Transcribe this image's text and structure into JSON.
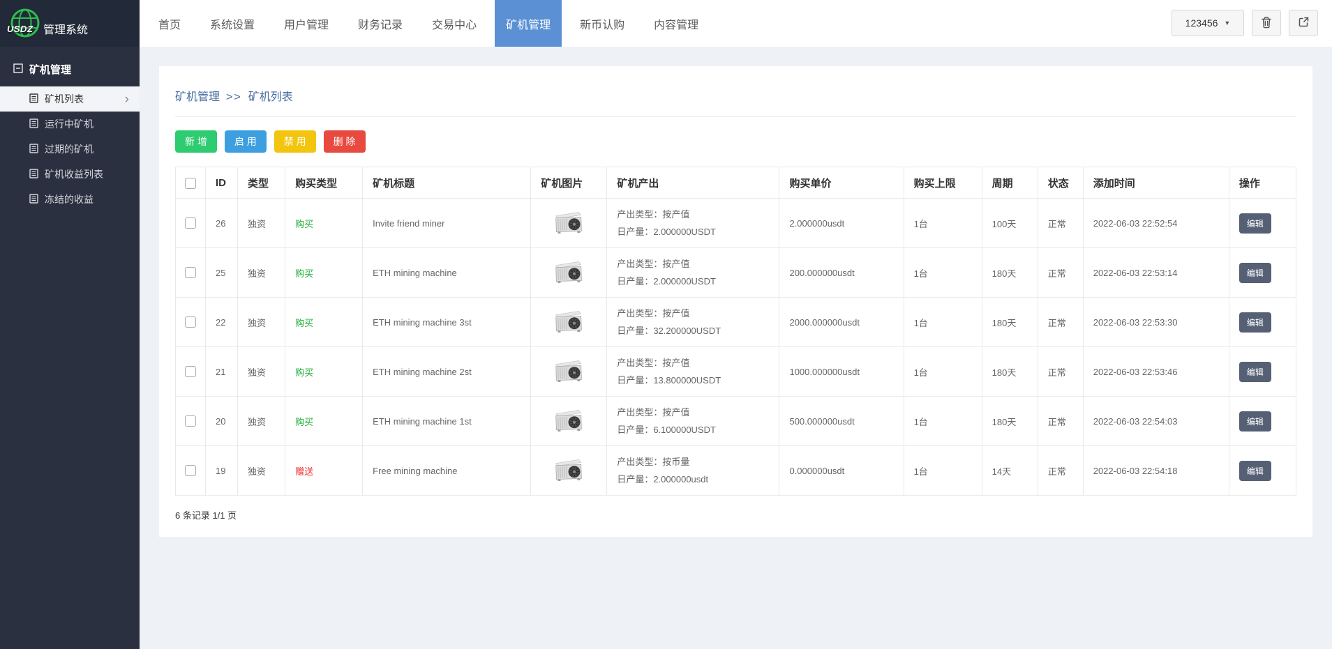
{
  "app": {
    "logo_text": "USDZ",
    "brand": "管理系统"
  },
  "topnav": {
    "items": [
      {
        "label": "首页",
        "active": false
      },
      {
        "label": "系统设置",
        "active": false
      },
      {
        "label": "用户管理",
        "active": false
      },
      {
        "label": "财务记录",
        "active": false
      },
      {
        "label": "交易中心",
        "active": false
      },
      {
        "label": "矿机管理",
        "active": true
      },
      {
        "label": "新币认购",
        "active": false
      },
      {
        "label": "内容管理",
        "active": false
      }
    ],
    "user_label": "123456"
  },
  "sidebar": {
    "section_title": "矿机管理",
    "items": [
      {
        "label": "矿机列表",
        "active": true
      },
      {
        "label": "运行中矿机",
        "active": false
      },
      {
        "label": "过期的矿机",
        "active": false
      },
      {
        "label": "矿机收益列表",
        "active": false
      },
      {
        "label": "冻结的收益",
        "active": false
      }
    ]
  },
  "breadcrumb": {
    "parent": "矿机管理",
    "separator": ">>",
    "current": "矿机列表"
  },
  "toolbar": {
    "add_label": "新 增",
    "enable_label": "启 用",
    "disable_label": "禁 用",
    "delete_label": "删 除"
  },
  "table": {
    "headers": {
      "id": "ID",
      "type": "类型",
      "buy_type": "购买类型",
      "title": "矿机标题",
      "image": "矿机图片",
      "output": "矿机产出",
      "price": "购买单价",
      "limit": "购买上限",
      "period": "周期",
      "status": "状态",
      "created": "添加时间",
      "actions": "操作"
    },
    "rows": [
      {
        "id": "26",
        "type": "独资",
        "buy_type": "购买",
        "buy_type_style": "green",
        "title": "Invite friend miner",
        "output_line1": "产出类型：按产值",
        "output_line2": "日产量：2.000000USDT",
        "price": "2.000000usdt",
        "limit": "1台",
        "period": "100天",
        "status": "正常",
        "created": "2022-06-03 22:52:54",
        "edit_label": "编辑"
      },
      {
        "id": "25",
        "type": "独资",
        "buy_type": "购买",
        "buy_type_style": "green",
        "title": "ETH mining machine",
        "output_line1": "产出类型：按产值",
        "output_line2": "日产量：2.000000USDT",
        "price": "200.000000usdt",
        "limit": "1台",
        "period": "180天",
        "status": "正常",
        "created": "2022-06-03 22:53:14",
        "edit_label": "编辑"
      },
      {
        "id": "22",
        "type": "独资",
        "buy_type": "购买",
        "buy_type_style": "green",
        "title": "ETH mining machine 3st",
        "output_line1": "产出类型：按产值",
        "output_line2": "日产量：32.200000USDT",
        "price": "2000.000000usdt",
        "limit": "1台",
        "period": "180天",
        "status": "正常",
        "created": "2022-06-03 22:53:30",
        "edit_label": "编辑"
      },
      {
        "id": "21",
        "type": "独资",
        "buy_type": "购买",
        "buy_type_style": "green",
        "title": "ETH mining machine 2st",
        "output_line1": "产出类型：按产值",
        "output_line2": "日产量：13.800000USDT",
        "price": "1000.000000usdt",
        "limit": "1台",
        "period": "180天",
        "status": "正常",
        "created": "2022-06-03 22:53:46",
        "edit_label": "编辑"
      },
      {
        "id": "20",
        "type": "独资",
        "buy_type": "购买",
        "buy_type_style": "green",
        "title": "ETH mining machine 1st",
        "output_line1": "产出类型：按产值",
        "output_line2": "日产量：6.100000USDT",
        "price": "500.000000usdt",
        "limit": "1台",
        "period": "180天",
        "status": "正常",
        "created": "2022-06-03 22:54:03",
        "edit_label": "编辑"
      },
      {
        "id": "19",
        "type": "独资",
        "buy_type": "赠送",
        "buy_type_style": "red",
        "title": "Free mining machine",
        "output_line1": "产出类型：按币量",
        "output_line2": "日产量：2.000000usdt",
        "price": "0.000000usdt",
        "limit": "1台",
        "period": "14天",
        "status": "正常",
        "created": "2022-06-03 22:54:18",
        "edit_label": "编辑"
      }
    ]
  },
  "pagination": {
    "summary": "6 条记录 1/1 页"
  },
  "colors": {
    "nav_active_blue": "#5b90d5",
    "breadcrumb_blue": "#44699f",
    "btn_green": "#2dcc70",
    "btn_blue": "#3d9fe0",
    "btn_yellow": "#f3c50e",
    "btn_red": "#e84a3f",
    "link_green": "#1fad33",
    "link_red": "#ef2b2b",
    "edit_btn_slate": "#566075",
    "sidebar_dark": "#2a3040",
    "logo_green": "#2ebd4e"
  }
}
